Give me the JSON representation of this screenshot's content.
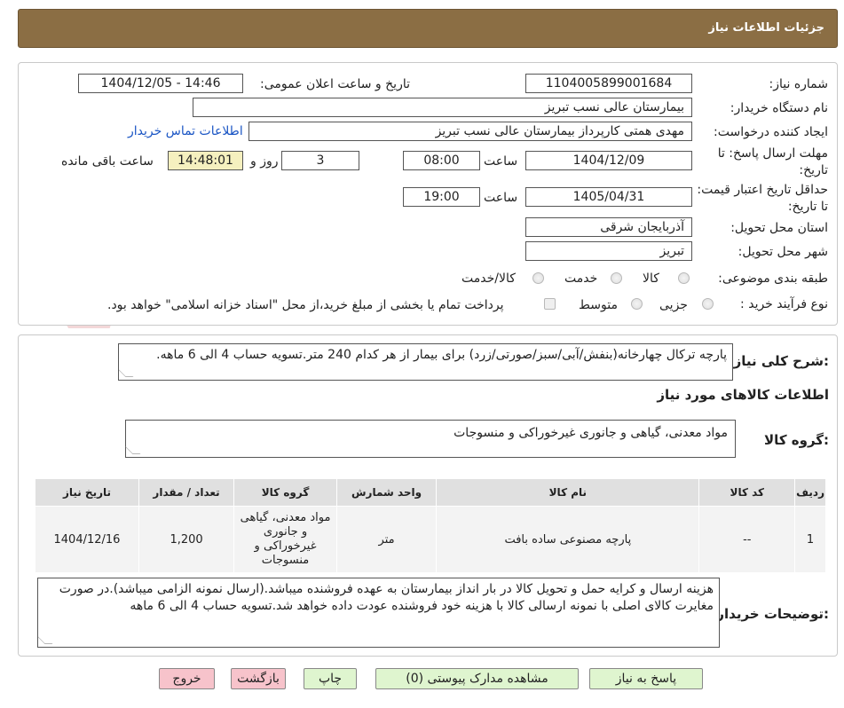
{
  "header": {
    "title": "جزئیات اطلاعات نیاز"
  },
  "form": {
    "need_number_label": "شماره نیاز:",
    "need_number": "1104005899001684",
    "announce_label": "تاریخ و ساعت اعلان عمومی:",
    "announce_value": "1404/12/05 - 14:46",
    "buyer_org_label": "نام دستگاه خریدار:",
    "buyer_org": "بیمارستان عالی نسب تبریز",
    "requester_label": "ایجاد کننده درخواست:",
    "requester": "مهدی همتی کارپرداز بیمارستان عالی نسب تبریز",
    "contact_link": "اطلاعات تماس خریدار",
    "deadline_label": "مهلت ارسال پاسخ: تا تاریخ:",
    "deadline_date": "1404/12/09",
    "time_label": "ساعت",
    "deadline_time": "08:00",
    "days_value": "3",
    "days_label": "روز و",
    "remaining_time": "14:48:01",
    "remaining_label": "ساعت باقی مانده",
    "validity_label": "حداقل تاریخ اعتبار قیمت: تا تاریخ:",
    "validity_date": "1405/04/31",
    "validity_time": "19:00",
    "province_label": "استان محل تحویل:",
    "province": "آذربایجان شرقی",
    "city_label": "شهر محل تحویل:",
    "city": "تبریز",
    "category_label": "طبقه بندی موضوعی:",
    "category_options": [
      "کالا",
      "خدمت",
      "کالا/خدمت"
    ],
    "process_label": "نوع فرآیند خرید :",
    "process_options": [
      "جزیی",
      "متوسط"
    ],
    "payment_note": "پرداخت تمام یا بخشی از مبلغ خرید،از محل \"اسناد خزانه اسلامی\" خواهد بود."
  },
  "summary": {
    "label": "شرح کلی نیاز:",
    "text": "پارچه ترکال چهارخانه(بنفش/آبی/سبز/صورتی/زرد) برای بیمار از هر کدام 240 متر.تسویه حساب 4 الی 6 ماهه."
  },
  "goods": {
    "section_title": "اطلاعات کالاهای مورد نیاز",
    "group_label": "گروه کالا:",
    "group_value": "مواد معدنی، گیاهی و جانوری غیرخوراکی و منسوجات"
  },
  "table": {
    "headers": [
      "ردیف",
      "کد کالا",
      "نام کالا",
      "واحد شمارش",
      "گروه کالا",
      "تعداد / مقدار",
      "تاریخ نیاز"
    ],
    "rows": [
      [
        "1",
        "--",
        "پارچه مصنوعی ساده بافت",
        "متر",
        "مواد معدنی، گیاهی و جانوری غیرخوراکی و منسوجات",
        "1,200",
        "1404/12/16"
      ]
    ]
  },
  "buyer_notes": {
    "label": "توضیحات خریدار:",
    "text": "هزینه ارسال و کرایه حمل و تحویل کالا در بار انداز بیمارستان به عهده فروشنده میباشد.(ارسال نمونه الزامی میباشد).در صورت مغایرت کالای اصلی با نمونه ارسالی کالا با هزینه خود فروشنده عودت داده خواهد شد.تسویه حساب 4 الی 6 ماهه"
  },
  "buttons": {
    "reply": "پاسخ به نیاز",
    "attachments": "مشاهده مدارک پیوستی (0)",
    "print": "چاپ",
    "back": "بازگشت",
    "exit": "خروج"
  },
  "watermark": {
    "text": "AriaTender.neT"
  },
  "colors": {
    "header_bg": "#8b6e44",
    "green_button": "#dff5cf",
    "red_button": "#f7c3cb",
    "remaining_bg": "#f5f0bf",
    "link": "#1a55c4"
  }
}
